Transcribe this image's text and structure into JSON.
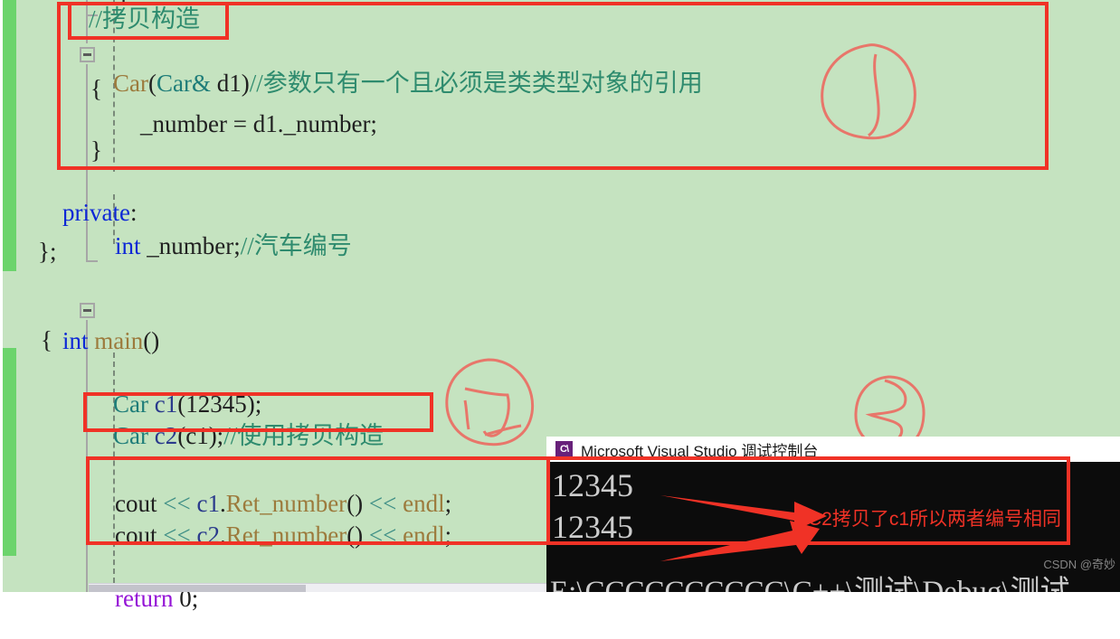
{
  "editor": {
    "language": "cpp",
    "background_color": "#c5e3c0",
    "change_bar_color": "#6cd46c",
    "lines": [
      {
        "id": "line-comment-copy-ctor",
        "text": "//拷贝构造",
        "token": "comment"
      },
      {
        "id": "line-copy-ctor-sig-type",
        "text": "Car",
        "token": "func"
      },
      {
        "id": "line-copy-ctor-sig-paren1",
        "text": "(",
        "token": "plain"
      },
      {
        "id": "line-copy-ctor-sig-argtype",
        "text": "Car&",
        "token": "type"
      },
      {
        "id": "line-copy-ctor-sig-argname",
        "text": " d1",
        "token": "plain"
      },
      {
        "id": "line-copy-ctor-sig-paren2",
        "text": ")",
        "token": "plain"
      },
      {
        "id": "line-copy-ctor-sig-comment",
        "text": "//参数只有一个且必须是类类型对象的引用",
        "token": "comment"
      },
      {
        "id": "line-open-brace",
        "text": "{",
        "token": "plain"
      },
      {
        "id": "line-assign",
        "text": "_number = d1._number;",
        "token": "plain"
      },
      {
        "id": "line-close-brace",
        "text": "}",
        "token": "plain"
      },
      {
        "id": "line-private",
        "text": "private",
        "token": "keyword"
      },
      {
        "id": "line-private-colon",
        "text": ":",
        "token": "plain"
      },
      {
        "id": "line-member-int",
        "text": "int",
        "token": "keyword"
      },
      {
        "id": "line-member-name",
        "text": " _number;",
        "token": "plain"
      },
      {
        "id": "line-member-comment",
        "text": "//汽车编号",
        "token": "comment"
      },
      {
        "id": "line-class-end",
        "text": "};",
        "token": "plain"
      },
      {
        "id": "line-main-int",
        "text": "int",
        "token": "keyword"
      },
      {
        "id": "line-main-name",
        "text": " main",
        "token": "func"
      },
      {
        "id": "line-main-parens",
        "text": "()",
        "token": "plain"
      },
      {
        "id": "line-main-open-brace",
        "text": "{",
        "token": "plain"
      },
      {
        "id": "line-c1-type",
        "text": "Car",
        "token": "type"
      },
      {
        "id": "line-c1-rest",
        "text": " c1",
        "token": "var"
      },
      {
        "id": "line-c1-args",
        "text": "(12345);",
        "token": "plain"
      },
      {
        "id": "line-c2-type",
        "text": "Car",
        "token": "type"
      },
      {
        "id": "line-c2-name",
        "text": " c2",
        "token": "var"
      },
      {
        "id": "line-c2-args",
        "text": "(c1);",
        "token": "plain"
      },
      {
        "id": "line-c2-comment",
        "text": "//使用拷贝构造",
        "token": "comment"
      },
      {
        "id": "line-cout1-cout",
        "text": "cout",
        "token": "plain"
      },
      {
        "id": "line-cout1-op1",
        "text": " << ",
        "token": "op"
      },
      {
        "id": "line-cout1-obj",
        "text": "c1",
        "token": "var"
      },
      {
        "id": "line-cout1-dot",
        "text": ".",
        "token": "plain"
      },
      {
        "id": "line-cout1-call",
        "text": "Ret_number",
        "token": "func"
      },
      {
        "id": "line-cout1-parens",
        "text": "()",
        "token": "plain"
      },
      {
        "id": "line-cout1-op2",
        "text": " << ",
        "token": "op"
      },
      {
        "id": "line-cout1-endl",
        "text": "endl",
        "token": "func"
      },
      {
        "id": "line-cout1-semi",
        "text": ";",
        "token": "plain"
      },
      {
        "id": "line-cout2-cout",
        "text": "cout",
        "token": "plain"
      },
      {
        "id": "line-cout2-op1",
        "text": " << ",
        "token": "op"
      },
      {
        "id": "line-cout2-obj",
        "text": "c2",
        "token": "var"
      },
      {
        "id": "line-cout2-dot",
        "text": ".",
        "token": "plain"
      },
      {
        "id": "line-cout2-call",
        "text": "Ret_number",
        "token": "func"
      },
      {
        "id": "line-cout2-parens",
        "text": "()",
        "token": "plain"
      },
      {
        "id": "line-cout2-op2",
        "text": " << ",
        "token": "op"
      },
      {
        "id": "line-cout2-endl",
        "text": "endl",
        "token": "func"
      },
      {
        "id": "line-cout2-semi",
        "text": ";",
        "token": "plain"
      },
      {
        "id": "line-return-kw",
        "text": "return",
        "token": "ctrl"
      },
      {
        "id": "line-return-val",
        "text": " 0;",
        "token": "plain"
      }
    ],
    "top_partial_brace": "}"
  },
  "annotations": {
    "box_color": "#f03226",
    "boxes": [
      {
        "name": "highlight-comment-copy-ctor"
      },
      {
        "name": "highlight-copy-constructor-block"
      },
      {
        "name": "highlight-copy-construct-usage"
      },
      {
        "name": "highlight-cout-statements"
      },
      {
        "name": "highlight-console-output"
      }
    ],
    "scribbles": [
      {
        "name": "scribble-near-copy-ctor"
      },
      {
        "name": "scribble-near-c2-line"
      },
      {
        "name": "scribble-near-console"
      }
    ]
  },
  "console": {
    "title": "Microsoft Visual Studio 调试控制台",
    "icon": "visual-studio-console-icon",
    "icon_color": "#68217a",
    "output_lines": [
      "12345",
      "12345"
    ],
    "path_line": "E:\\CCCCCCCCCC\\C++\\测试\\Debug\\测试",
    "annotation_text": "C2拷贝了c1所以两者编号相同",
    "annotation_color": "#f03226",
    "arrows": [
      {
        "name": "arrow-to-first-output"
      },
      {
        "name": "arrow-to-second-output"
      }
    ]
  },
  "watermark": {
    "text": "CSDN @奇妙"
  }
}
